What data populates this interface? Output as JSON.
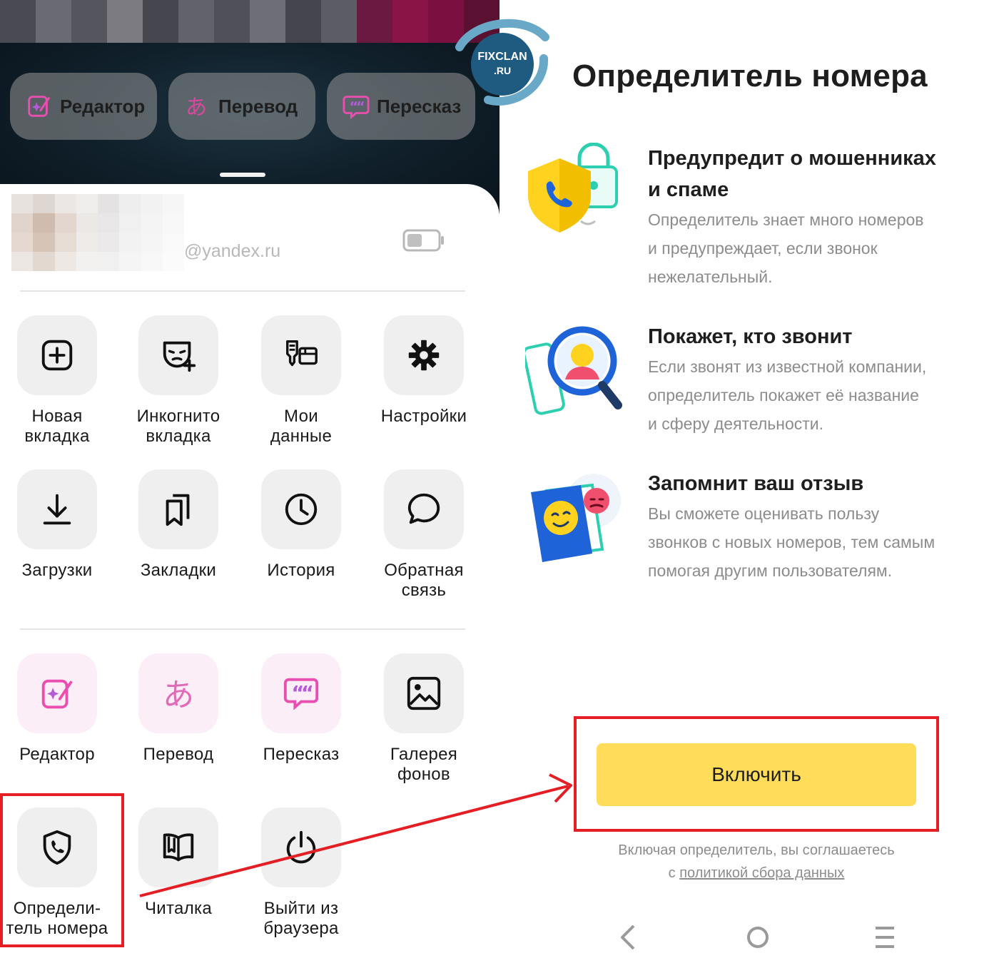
{
  "left": {
    "chips": [
      {
        "label": "Редактор",
        "icon": "editor-sparkle-icon"
      },
      {
        "label": "Перевод",
        "icon": "translate-icon"
      },
      {
        "label": "Пересказ",
        "icon": "retell-quote-icon"
      }
    ],
    "account": {
      "email": "@yandex.ru"
    },
    "menu_main": [
      {
        "label": "Новая\nвкладка",
        "icon": "new-tab-icon"
      },
      {
        "label": "Инкогнито\nвкладка",
        "icon": "incognito-icon"
      },
      {
        "label": "Мои\nданные",
        "icon": "my-data-icon"
      },
      {
        "label": "Настройки",
        "icon": "gear-icon"
      },
      {
        "label": "Загрузки",
        "icon": "download-icon"
      },
      {
        "label": "Закладки",
        "icon": "bookmarks-icon"
      },
      {
        "label": "История",
        "icon": "clock-icon"
      },
      {
        "label": "Обратная\nсвязь",
        "icon": "chat-bubble-icon"
      }
    ],
    "menu_tools": [
      {
        "label": "Редактор",
        "icon": "editor-sparkle-icon"
      },
      {
        "label": "Перевод",
        "icon": "translate-icon"
      },
      {
        "label": "Пересказ",
        "icon": "retell-quote-icon"
      },
      {
        "label": "Галерея\nфонов",
        "icon": "image-gallery-icon"
      },
      {
        "label": "Определи-\nтель номера",
        "icon": "shield-phone-icon"
      },
      {
        "label": "Читалка",
        "icon": "book-icon"
      },
      {
        "label": "Выйти из\nбраузера",
        "icon": "power-icon"
      }
    ]
  },
  "watermark": {
    "line1": "FIXCLAN",
    "line2": ".RU"
  },
  "right": {
    "title": "Определитель номера",
    "features": [
      {
        "heading": "Предупредит о мошенниках\nи спаме",
        "text": "Определитель знает много номеров\nи предупреждает, если звонок\nнежелательный.",
        "icon": "shield-lock-phone-illustration"
      },
      {
        "heading": "Покажет, кто звонит",
        "text": "Если звонят из известной компании,\nопределитель покажет её название\nи сферу деятельности.",
        "icon": "magnifier-caller-illustration"
      },
      {
        "heading": "Запомнит ваш отзыв",
        "text": "Вы сможете оценивать пользу\nзвонков с новых номеров, тем самым\nпомогая другим пользователям.",
        "icon": "feedback-smiles-illustration"
      }
    ],
    "enable_button": "Включить",
    "consent_prefix": "Включая определитель, вы соглашаетесь",
    "consent_c": "с",
    "consent_link": "политикой сбора данных"
  },
  "colors": {
    "accent_yellow": "#ffdc5a",
    "highlight_red": "#e31e24",
    "pink_icon": "#e94fb0"
  }
}
